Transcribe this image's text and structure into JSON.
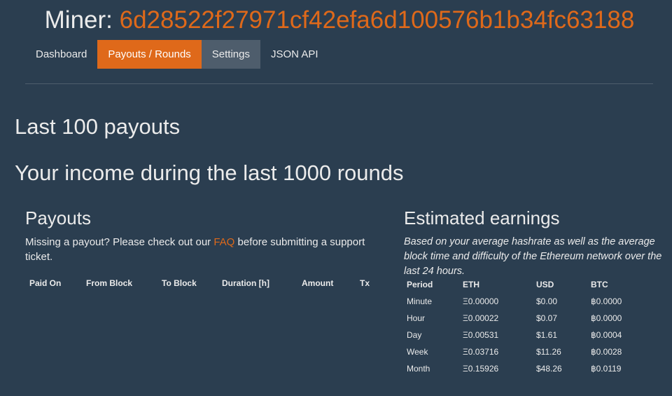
{
  "header": {
    "label": "Miner:",
    "address": "6d28522f27971cf42efa6d100576b1b34fc63188"
  },
  "nav": {
    "tabs": [
      {
        "label": "Dashboard",
        "state": "normal"
      },
      {
        "label": "Payouts / Rounds",
        "state": "active"
      },
      {
        "label": "Settings",
        "state": "secondary"
      },
      {
        "label": "JSON API",
        "state": "normal"
      }
    ]
  },
  "sections": {
    "last_payouts": "Last 100 payouts",
    "income": "Your income during the last 1000 rounds"
  },
  "payouts": {
    "title": "Payouts",
    "note_before": "Missing a payout? Please check out our ",
    "note_link": "FAQ",
    "note_after": " before submitting a support ticket.",
    "columns": [
      "Paid On",
      "From Block",
      "To Block",
      "Duration [h]",
      "Amount",
      "Tx"
    ]
  },
  "estimated": {
    "title": "Estimated earnings",
    "note": "Based on your average hashrate as well as the average block time and difficulty of the Ethereum network over the last 24 hours.",
    "columns": [
      "Period",
      "ETH",
      "USD",
      "BTC"
    ],
    "rows": [
      [
        "Minute",
        "Ξ0.00000",
        "$0.00",
        "฿0.0000"
      ],
      [
        "Hour",
        "Ξ0.00022",
        "$0.07",
        "฿0.0000"
      ],
      [
        "Day",
        "Ξ0.00531",
        "$1.61",
        "฿0.0004"
      ],
      [
        "Week",
        "Ξ0.03716",
        "$11.26",
        "฿0.0028"
      ],
      [
        "Month",
        "Ξ0.15926",
        "$48.26",
        "฿0.0119"
      ]
    ]
  },
  "colors": {
    "background": "#2b3e50",
    "accent": "#df691a",
    "secondary": "#4e5d6c",
    "text": "#ebebeb"
  }
}
